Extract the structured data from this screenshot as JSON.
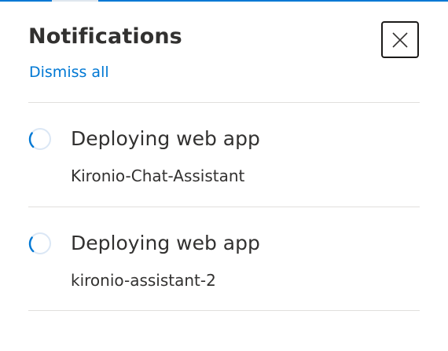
{
  "panel": {
    "title": "Notifications",
    "dismiss_all_label": "Dismiss all",
    "close_icon": "close-icon",
    "accent_color": "#0078d4"
  },
  "notifications": [
    {
      "title": "Deploying web app",
      "subtitle": "Kironio-Chat-Assistant",
      "status_icon": "loading-spinner-icon"
    },
    {
      "title": "Deploying web app",
      "subtitle": "kironio-assistant-2",
      "status_icon": "loading-spinner-icon"
    }
  ]
}
